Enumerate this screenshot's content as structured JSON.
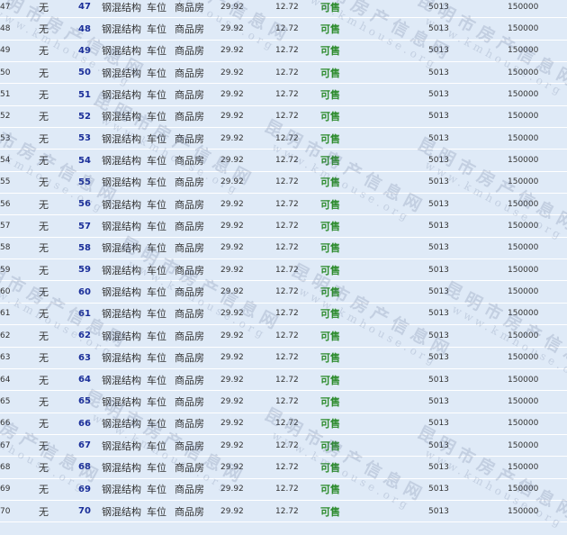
{
  "watermark": {
    "cn": "昆明市房产信息网",
    "url": "www.kmhouse.org"
  },
  "rows": [
    {
      "no": "47",
      "reserve": "无",
      "room": "47",
      "structure": "钢混结构",
      "type": "车位",
      "usage": "商品房",
      "area": "29.92",
      "inner_area": "12.72",
      "status": "可售",
      "unit_price": "5013",
      "total_price": "150000"
    },
    {
      "no": "48",
      "reserve": "无",
      "room": "48",
      "structure": "钢混结构",
      "type": "车位",
      "usage": "商品房",
      "area": "29.92",
      "inner_area": "12.72",
      "status": "可售",
      "unit_price": "5013",
      "total_price": "150000"
    },
    {
      "no": "49",
      "reserve": "无",
      "room": "49",
      "structure": "钢混结构",
      "type": "车位",
      "usage": "商品房",
      "area": "29.92",
      "inner_area": "12.72",
      "status": "可售",
      "unit_price": "5013",
      "total_price": "150000"
    },
    {
      "no": "50",
      "reserve": "无",
      "room": "50",
      "structure": "钢混结构",
      "type": "车位",
      "usage": "商品房",
      "area": "29.92",
      "inner_area": "12.72",
      "status": "可售",
      "unit_price": "5013",
      "total_price": "150000"
    },
    {
      "no": "51",
      "reserve": "无",
      "room": "51",
      "structure": "钢混结构",
      "type": "车位",
      "usage": "商品房",
      "area": "29.92",
      "inner_area": "12.72",
      "status": "可售",
      "unit_price": "5013",
      "total_price": "150000"
    },
    {
      "no": "52",
      "reserve": "无",
      "room": "52",
      "structure": "钢混结构",
      "type": "车位",
      "usage": "商品房",
      "area": "29.92",
      "inner_area": "12.72",
      "status": "可售",
      "unit_price": "5013",
      "total_price": "150000"
    },
    {
      "no": "53",
      "reserve": "无",
      "room": "53",
      "structure": "钢混结构",
      "type": "车位",
      "usage": "商品房",
      "area": "29.92",
      "inner_area": "12.72",
      "status": "可售",
      "unit_price": "5013",
      "total_price": "150000"
    },
    {
      "no": "54",
      "reserve": "无",
      "room": "54",
      "structure": "钢混结构",
      "type": "车位",
      "usage": "商品房",
      "area": "29.92",
      "inner_area": "12.72",
      "status": "可售",
      "unit_price": "5013",
      "total_price": "150000"
    },
    {
      "no": "55",
      "reserve": "无",
      "room": "55",
      "structure": "钢混结构",
      "type": "车位",
      "usage": "商品房",
      "area": "29.92",
      "inner_area": "12.72",
      "status": "可售",
      "unit_price": "5013",
      "total_price": "150000"
    },
    {
      "no": "56",
      "reserve": "无",
      "room": "56",
      "structure": "钢混结构",
      "type": "车位",
      "usage": "商品房",
      "area": "29.92",
      "inner_area": "12.72",
      "status": "可售",
      "unit_price": "5013",
      "total_price": "150000"
    },
    {
      "no": "57",
      "reserve": "无",
      "room": "57",
      "structure": "钢混结构",
      "type": "车位",
      "usage": "商品房",
      "area": "29.92",
      "inner_area": "12.72",
      "status": "可售",
      "unit_price": "5013",
      "total_price": "150000"
    },
    {
      "no": "58",
      "reserve": "无",
      "room": "58",
      "structure": "钢混结构",
      "type": "车位",
      "usage": "商品房",
      "area": "29.92",
      "inner_area": "12.72",
      "status": "可售",
      "unit_price": "5013",
      "total_price": "150000"
    },
    {
      "no": "59",
      "reserve": "无",
      "room": "59",
      "structure": "钢混结构",
      "type": "车位",
      "usage": "商品房",
      "area": "29.92",
      "inner_area": "12.72",
      "status": "可售",
      "unit_price": "5013",
      "total_price": "150000"
    },
    {
      "no": "60",
      "reserve": "无",
      "room": "60",
      "structure": "钢混结构",
      "type": "车位",
      "usage": "商品房",
      "area": "29.92",
      "inner_area": "12.72",
      "status": "可售",
      "unit_price": "5013",
      "total_price": "150000"
    },
    {
      "no": "61",
      "reserve": "无",
      "room": "61",
      "structure": "钢混结构",
      "type": "车位",
      "usage": "商品房",
      "area": "29.92",
      "inner_area": "12.72",
      "status": "可售",
      "unit_price": "5013",
      "total_price": "150000"
    },
    {
      "no": "62",
      "reserve": "无",
      "room": "62",
      "structure": "钢混结构",
      "type": "车位",
      "usage": "商品房",
      "area": "29.92",
      "inner_area": "12.72",
      "status": "可售",
      "unit_price": "5013",
      "total_price": "150000"
    },
    {
      "no": "63",
      "reserve": "无",
      "room": "63",
      "structure": "钢混结构",
      "type": "车位",
      "usage": "商品房",
      "area": "29.92",
      "inner_area": "12.72",
      "status": "可售",
      "unit_price": "5013",
      "total_price": "150000"
    },
    {
      "no": "64",
      "reserve": "无",
      "room": "64",
      "structure": "钢混结构",
      "type": "车位",
      "usage": "商品房",
      "area": "29.92",
      "inner_area": "12.72",
      "status": "可售",
      "unit_price": "5013",
      "total_price": "150000"
    },
    {
      "no": "65",
      "reserve": "无",
      "room": "65",
      "structure": "钢混结构",
      "type": "车位",
      "usage": "商品房",
      "area": "29.92",
      "inner_area": "12.72",
      "status": "可售",
      "unit_price": "5013",
      "total_price": "150000"
    },
    {
      "no": "66",
      "reserve": "无",
      "room": "66",
      "structure": "钢混结构",
      "type": "车位",
      "usage": "商品房",
      "area": "29.92",
      "inner_area": "12.72",
      "status": "可售",
      "unit_price": "5013",
      "total_price": "150000"
    },
    {
      "no": "67",
      "reserve": "无",
      "room": "67",
      "structure": "钢混结构",
      "type": "车位",
      "usage": "商品房",
      "area": "29.92",
      "inner_area": "12.72",
      "status": "可售",
      "unit_price": "5013",
      "total_price": "150000"
    },
    {
      "no": "68",
      "reserve": "无",
      "room": "68",
      "structure": "钢混结构",
      "type": "车位",
      "usage": "商品房",
      "area": "29.92",
      "inner_area": "12.72",
      "status": "可售",
      "unit_price": "5013",
      "total_price": "150000"
    },
    {
      "no": "69",
      "reserve": "无",
      "room": "69",
      "structure": "钢混结构",
      "type": "车位",
      "usage": "商品房",
      "area": "29.92",
      "inner_area": "12.72",
      "status": "可售",
      "unit_price": "5013",
      "total_price": "150000"
    },
    {
      "no": "70",
      "reserve": "无",
      "room": "70",
      "structure": "钢混结构",
      "type": "车位",
      "usage": "商品房",
      "area": "29.92",
      "inner_area": "12.72",
      "status": "可售",
      "unit_price": "5013",
      "total_price": "150000"
    }
  ]
}
